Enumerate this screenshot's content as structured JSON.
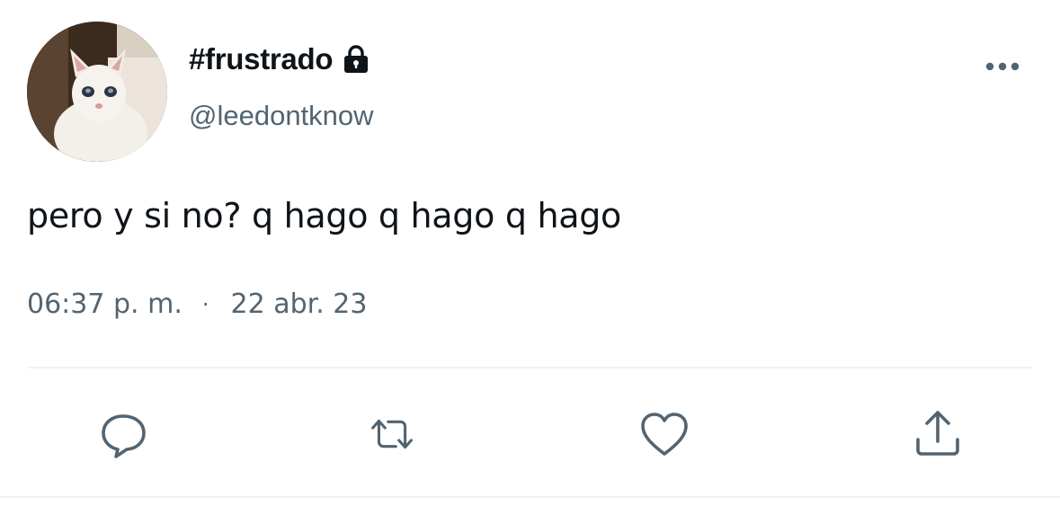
{
  "user": {
    "display_name": "#frustrado",
    "handle": "@leedontknow",
    "protected_icon": "lock-icon",
    "avatar": "white-cat-photo"
  },
  "tweet": {
    "text": "pero y si no? q hago q hago q hago",
    "time": "06:37 p. m.",
    "separator": "·",
    "date": "22 abr. 23"
  },
  "actions": {
    "reply_icon": "reply-icon",
    "retweet_icon": "retweet-icon",
    "like_icon": "heart-icon",
    "share_icon": "share-icon",
    "more_icon": "more-options-icon"
  },
  "colors": {
    "text_primary": "#0f1419",
    "text_secondary": "#536471",
    "divider": "#eff3f4"
  }
}
